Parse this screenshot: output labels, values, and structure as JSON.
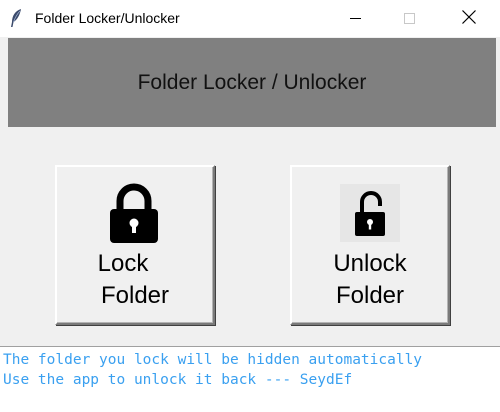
{
  "window": {
    "title": "Folder Locker/Unlocker",
    "icon": "feather-icon"
  },
  "controls": {
    "minimize": "minimize-icon",
    "maximize": "maximize-icon",
    "close": "close-icon"
  },
  "banner": {
    "title": "Folder Locker / Unlocker",
    "background": "#808080"
  },
  "buttons": {
    "lock": {
      "line1": "Lock",
      "line2": "Folder",
      "icon": "lock-closed-icon"
    },
    "unlock": {
      "line1": "Unlock",
      "line2": "Folder",
      "icon": "lock-open-icon"
    }
  },
  "log": {
    "lines": [
      "The folder you lock will be hidden automatically",
      "Use the app to unlock it back --- SeydEf"
    ],
    "color": "#3aa0f0"
  }
}
